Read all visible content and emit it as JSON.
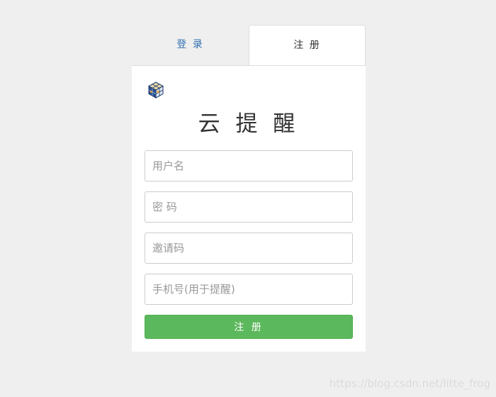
{
  "tabs": {
    "login_label": "登 录",
    "register_label": "注 册",
    "active": "register"
  },
  "brand": {
    "logo_icon": "cube-logo-icon",
    "title": "云 提 醒"
  },
  "form": {
    "username_placeholder": "用户名",
    "password_placeholder": "密 码",
    "invite_placeholder": "邀请码",
    "phone_placeholder": "手机号(用于提醒)",
    "submit_label": "注 册"
  },
  "watermark": "https://blog.csdn.net/litte_frog",
  "colors": {
    "background": "#efefef",
    "tab_link": "#2f6fb0",
    "submit_bg": "#5cb85c",
    "panel_bg": "#ffffff"
  }
}
